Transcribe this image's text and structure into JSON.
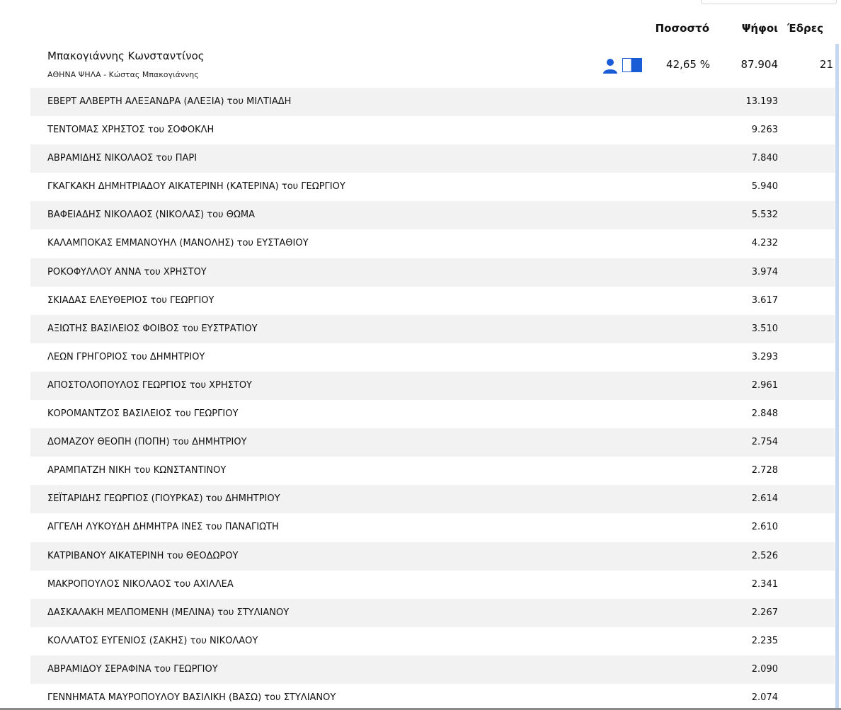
{
  "header": {
    "pct_label": "Ποσοστό",
    "votes_label": "Ψήφοι",
    "seats_label": "Έδρες"
  },
  "party": {
    "name": "Μπακογιάννης Κωνσταντίνος",
    "subtitle": "ΑΘΗΝΑ ΨΗΛΑ - Κώστας Μπακογιάννης",
    "percentage": "42,65 %",
    "votes": "87.904",
    "seats": "21",
    "icons": [
      "person-icon",
      "flag-icon"
    ],
    "accent_color": "#1a5bd6"
  },
  "candidates": [
    {
      "name": "ΕΒΕΡΤ ΑΛΒΕΡΤΗ ΑΛΕΞΑΝΔΡΑ (ΑΛΕΞΙΑ) του ΜΙΛΤΙΑΔΗ",
      "votes": "13.193"
    },
    {
      "name": "ΤΕΝΤΟΜΑΣ ΧΡΗΣΤΟΣ του ΣΟΦΟΚΛΗ",
      "votes": "9.263"
    },
    {
      "name": "ΑΒΡΑΜΙΔΗΣ ΝΙΚΟΛΑΟΣ του ΠΑΡΙ",
      "votes": "7.840"
    },
    {
      "name": "ΓΚΑΓΚΑΚΗ ΔΗΜΗΤΡΙΑΔΟΥ ΑΙΚΑΤΕΡΙΝΗ (ΚΑΤΕΡΙΝΑ) του ΓΕΩΡΓΙΟΥ",
      "votes": "5.940"
    },
    {
      "name": "ΒΑΦΕΙΑΔΗΣ ΝΙΚΟΛΑΟΣ (ΝΙΚΟΛΑΣ) του ΘΩΜΑ",
      "votes": "5.532"
    },
    {
      "name": "ΚΑΛΑΜΠΟΚΑΣ ΕΜΜΑΝΟΥΗΛ (ΜΑΝΟΛΗΣ) του ΕΥΣΤΑΘΙΟΥ",
      "votes": "4.232"
    },
    {
      "name": "ΡΟΚΟΦΥΛΛΟΥ ΑΝΝΑ του ΧΡΗΣΤΟΥ",
      "votes": "3.974"
    },
    {
      "name": "ΣΚΙΑΔΑΣ ΕΛΕΥΘΕΡΙΟΣ του ΓΕΩΡΓΙΟΥ",
      "votes": "3.617"
    },
    {
      "name": "ΑΞΙΩΤΗΣ ΒΑΣΙΛΕΙΟΣ ΦΟΙΒΟΣ του ΕΥΣΤΡΑΤΙΟΥ",
      "votes": "3.510"
    },
    {
      "name": "ΛΕΩΝ ΓΡΗΓΟΡΙΟΣ του ΔΗΜΗΤΡΙΟΥ",
      "votes": "3.293"
    },
    {
      "name": "ΑΠΟΣΤΟΛΟΠΟΥΛΟΣ ΓΕΩΡΓΙΟΣ του ΧΡΗΣΤΟΥ",
      "votes": "2.961"
    },
    {
      "name": "ΚΟΡΟΜΑΝΤΖΟΣ ΒΑΣΙΛΕΙΟΣ του ΓΕΩΡΓΙΟΥ",
      "votes": "2.848"
    },
    {
      "name": "ΔΟΜΑΖΟΥ ΘΕΟΠΗ (ΠΟΠΗ) του ΔΗΜΗΤΡΙΟΥ",
      "votes": "2.754"
    },
    {
      "name": "ΑΡΑΜΠΑΤΖΗ ΝΙΚΗ του ΚΩΝΣΤΑΝΤΙΝΟΥ",
      "votes": "2.728"
    },
    {
      "name": "ΣΕΪΤΑΡΙΔΗΣ ΓΕΩΡΓΙΟΣ (ΓΙΟΥΡΚΑΣ) του ΔΗΜΗΤΡΙΟΥ",
      "votes": "2.614"
    },
    {
      "name": "ΑΓΓΕΛΗ ΛΥΚΟΥΔΗ ΔΗΜΗΤΡΑ ΙΝΕΣ του ΠΑΝΑΓΙΩΤΗ",
      "votes": "2.610"
    },
    {
      "name": "ΚΑΤΡΙΒΑΝΟΥ ΑΙΚΑΤΕΡΙΝΗ του ΘΕΟΔΩΡΟΥ",
      "votes": "2.526"
    },
    {
      "name": "ΜΑΚΡΟΠΟΥΛΟΣ ΝΙΚΟΛΑΟΣ του ΑΧΙΛΛΕΑ",
      "votes": "2.341"
    },
    {
      "name": "ΔΑΣΚΑΛΑΚΗ ΜΕΛΠΟΜΕΝΗ (ΜΕΛΙΝΑ) του ΣΤΥΛΙΑΝΟΥ",
      "votes": "2.267"
    },
    {
      "name": "ΚΟΛΛΑΤΟΣ ΕΥΓΕΝΙΟΣ (ΣΑΚΗΣ) του ΝΙΚΟΛΑΟΥ",
      "votes": "2.235"
    },
    {
      "name": "ΑΒΡΑΜΙΔΟΥ ΣΕΡΑΦΙΝΑ του ΓΕΩΡΓΙΟΥ",
      "votes": "2.090"
    },
    {
      "name": "ΓΕΝΝΗΜΑΤΑ ΜΑΥΡΟΠΟΥΛΟΥ ΒΑΣΙΛΙΚΗ (ΒΑΣΩ) του ΣΤΥΛΙΑΝΟΥ",
      "votes": "2.074"
    }
  ]
}
